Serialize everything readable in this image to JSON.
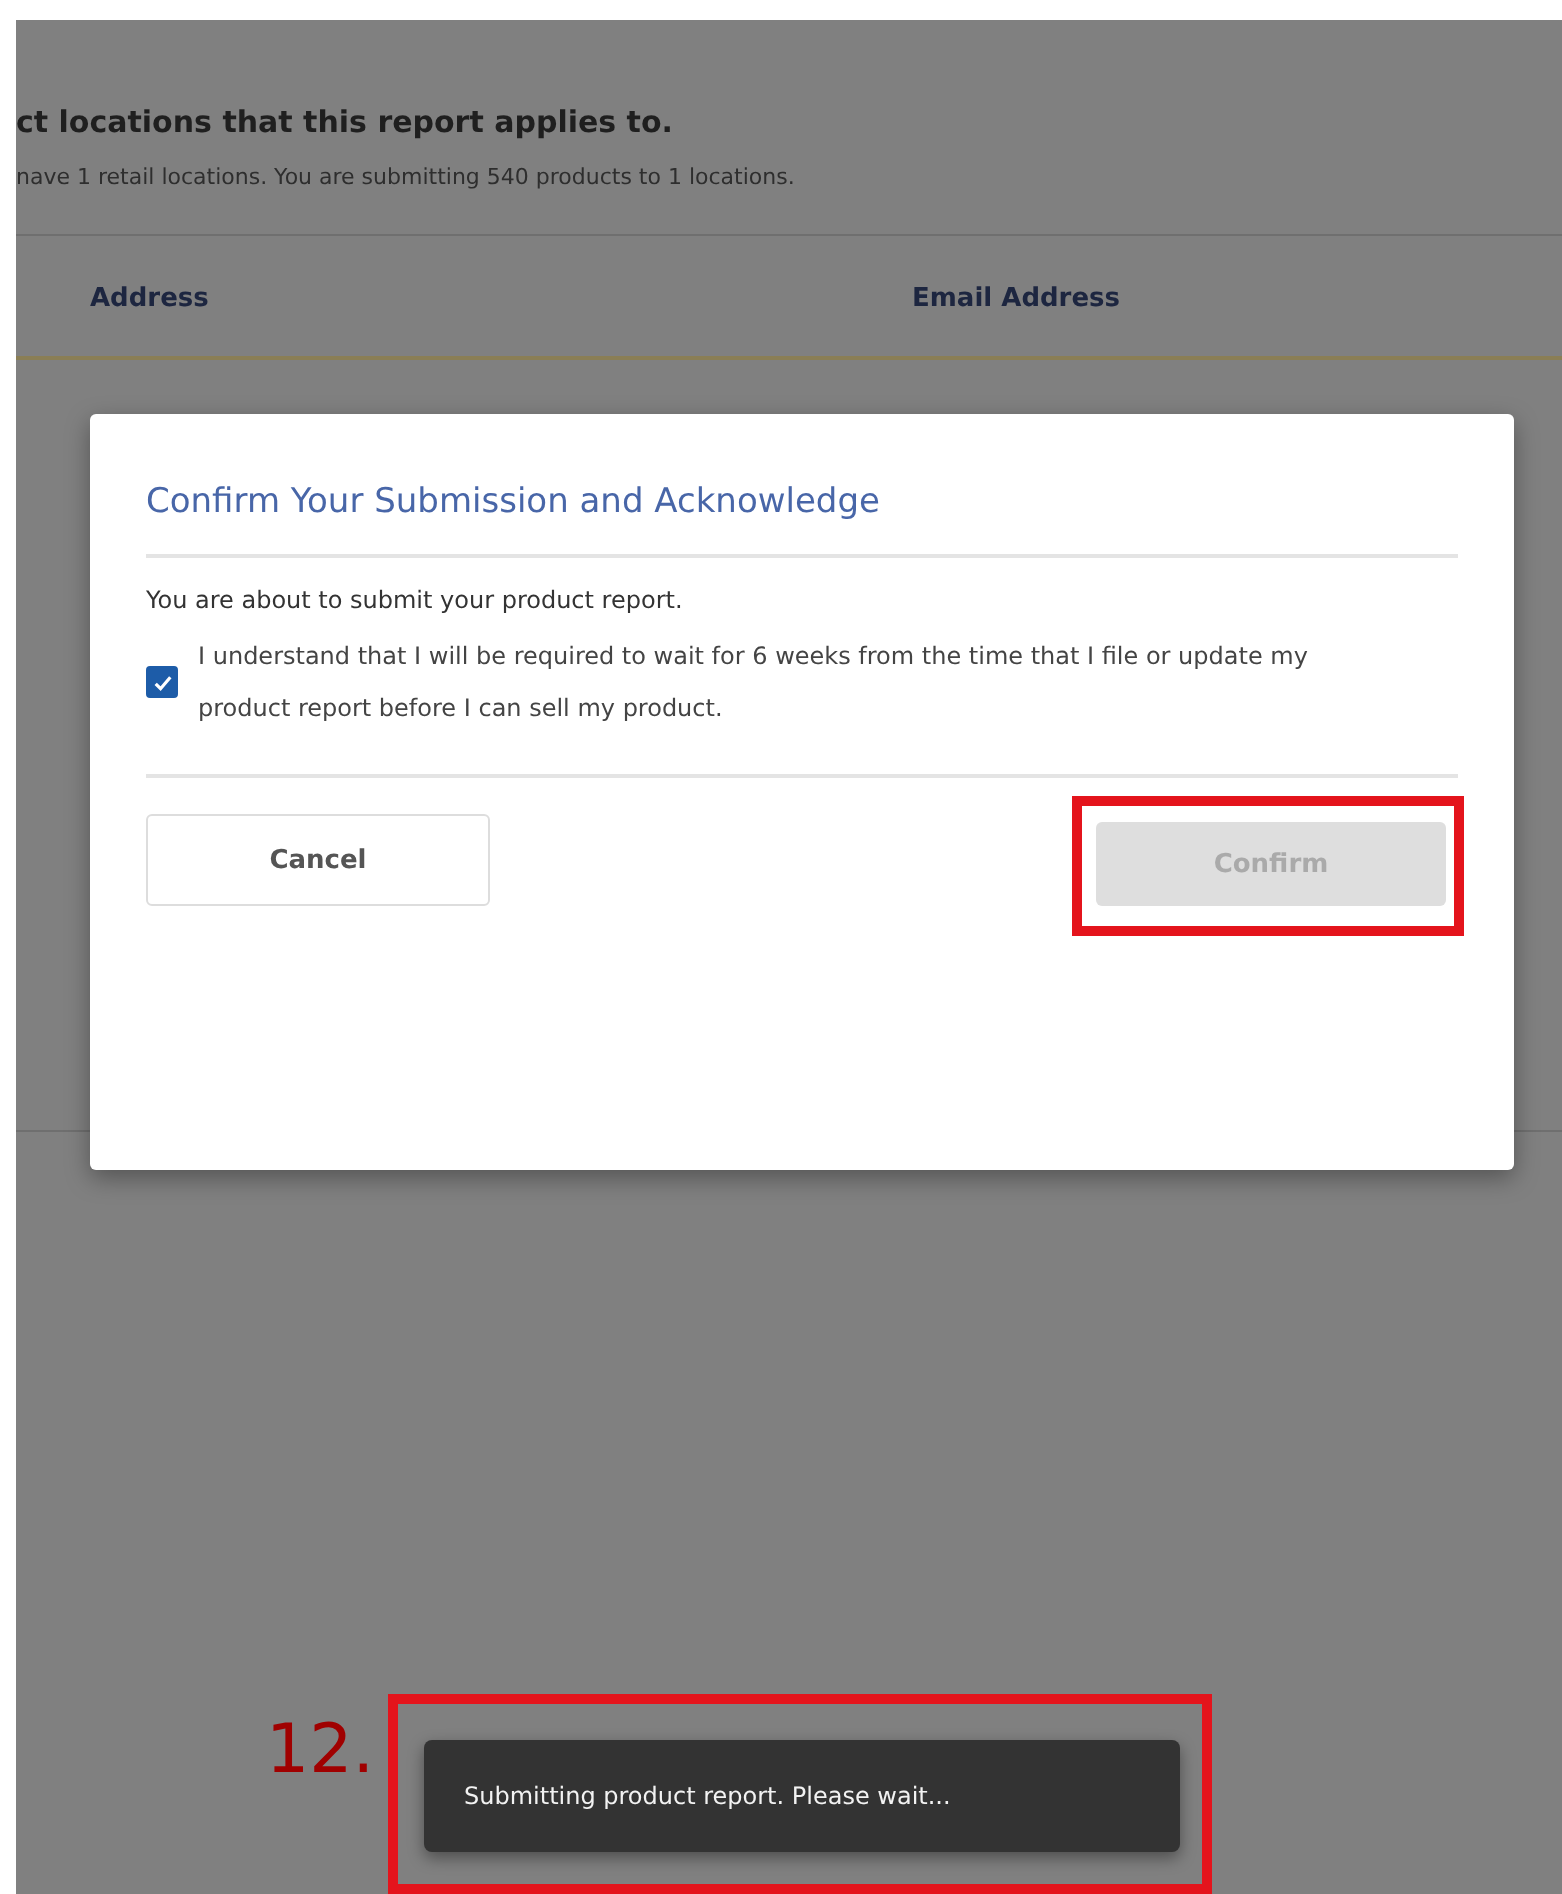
{
  "page": {
    "heading": "ct locations that this report applies to.",
    "subtext": "nave 1 retail locations. You are submitting 540 products to 1 locations.",
    "table": {
      "columns": [
        "Address",
        "Email Address"
      ]
    }
  },
  "dialog": {
    "title": "Confirm Your Submission and Acknowledge",
    "message": "You are about to submit your product report.",
    "acknowledgement": {
      "label": "I understand that I will be required to wait for 6 weeks from the time that I file or update my product report before I can sell my product.",
      "checked": true
    },
    "buttons": [
      {
        "label": "Cancel",
        "kind": "secondary",
        "disabled": false
      },
      {
        "label": "Confirm",
        "kind": "primary",
        "disabled": true
      }
    ]
  },
  "toast": {
    "message": "Submitting product report. Please wait..."
  },
  "annotation": {
    "step": "12."
  }
}
